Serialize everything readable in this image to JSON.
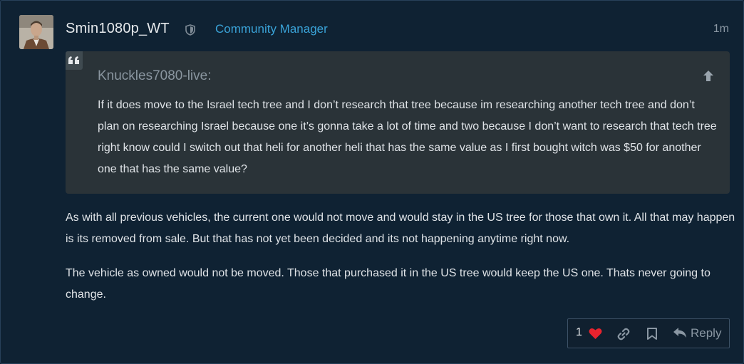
{
  "post": {
    "username": "Smin1080p_WT",
    "user_title": "Community Manager",
    "time": "1m",
    "quote": {
      "author": "Knuckles7080-live:",
      "text": "If it does move to the Israel tech tree and I don’t research that tree because im researching another tech tree and don’t plan on researching Israel because one it’s gonna take a lot of time and two because I don’t want to research that tech tree right know could I switch out that heli for another heli that has the same value as I first bought witch was $50 for another one that has the same value?"
    },
    "paragraphs": [
      "As with all previous vehicles, the current one would not move and would stay in the US tree for those that own it. All that may happen is its removed from sale. But that has not yet been decided and its not happening anytime right now.",
      "The vehicle as owned would not be moved. Those that purchased it in the US tree would keep the US one. Thats never going to change."
    ],
    "actions": {
      "like_count": "1",
      "reply_label": "Reply"
    }
  },
  "colors": {
    "background": "#0f2233",
    "quote_background": "#2a3338",
    "user_title": "#3aa3d8",
    "heart": "#e8232e"
  },
  "icons": {
    "moderator": "shield-icon",
    "quote": "quote-icon",
    "jump_to_post": "arrow-up-icon",
    "like": "heart-icon",
    "share": "link-icon",
    "bookmark": "bookmark-icon",
    "reply": "reply-icon"
  }
}
